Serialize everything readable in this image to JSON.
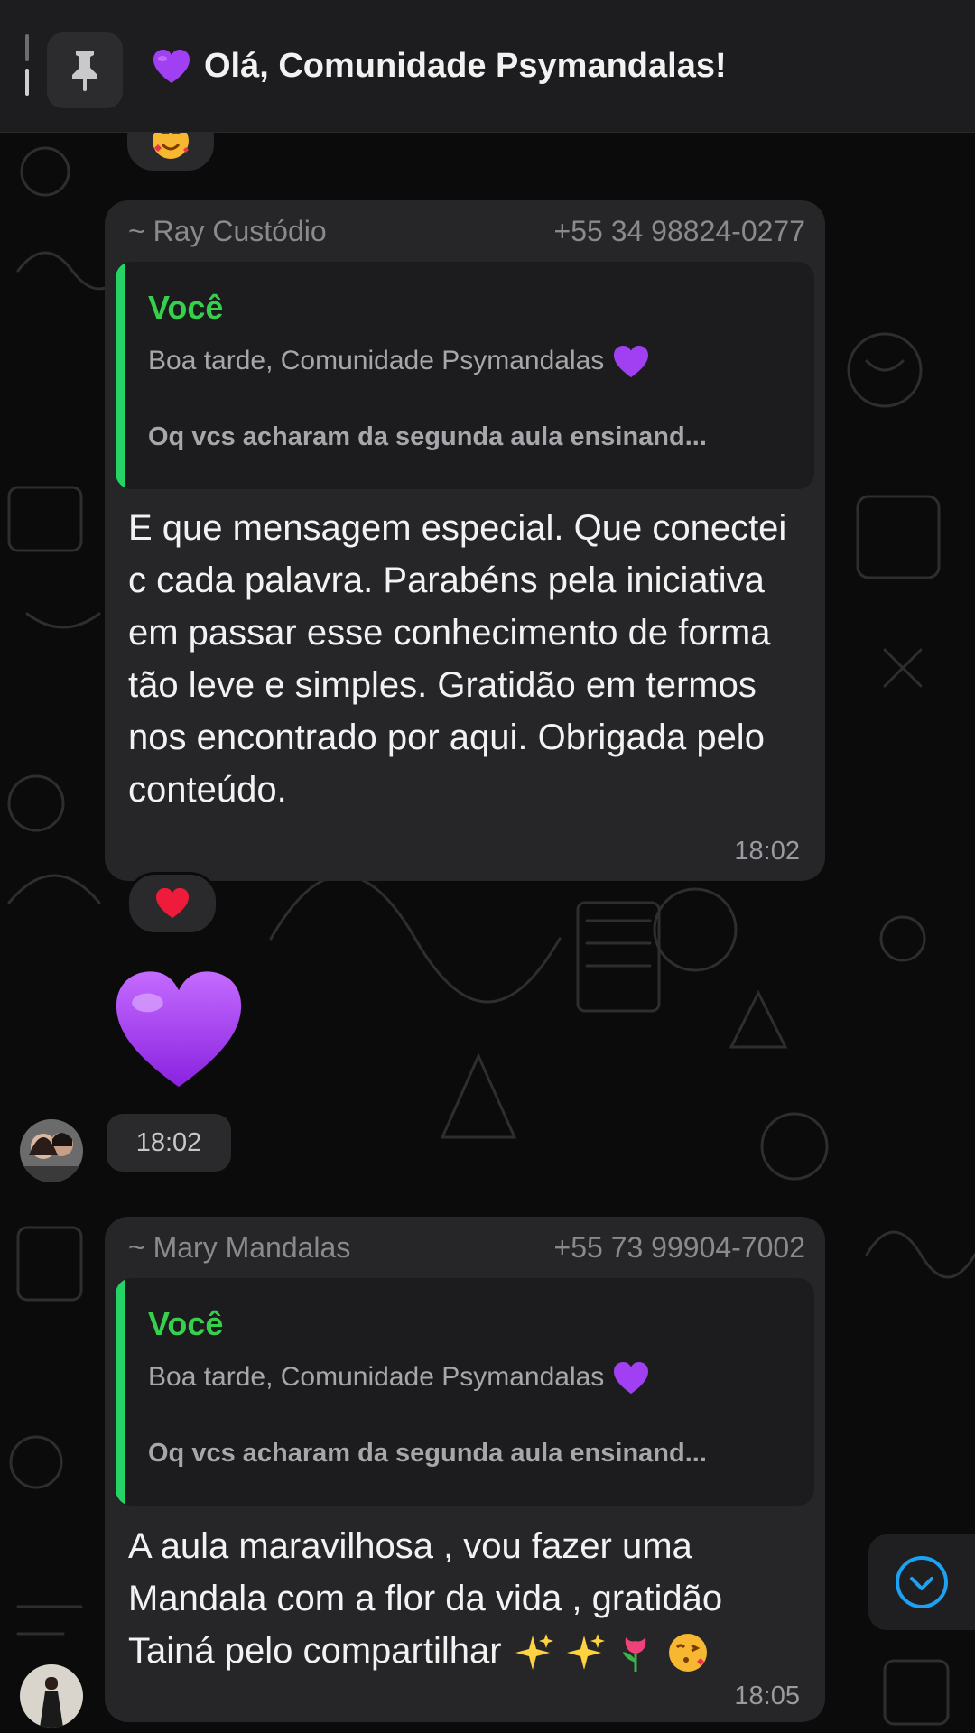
{
  "pinned": {
    "title": "Olá, Comunidade Psymandalas!",
    "icon": "pin-icon",
    "heart_color": "#9b3ff0"
  },
  "messages": [
    {
      "sender": "~ Ray Custódio",
      "phone": "+55 34 98824-0277",
      "quote": {
        "author": "Você",
        "line1": "Boa tarde, Comunidade Psymandalas",
        "line2": "Oq vcs acharam da segunda aula ensinand..."
      },
      "text": "E que mensagem especial. Que conectei c cada palavra. Parabéns pela iniciativa em passar esse conhecimento de forma tão leve e simples. Gratidão em termos nos encontrado por aqui. Obrigada pelo conteúdo.",
      "time": "18:02",
      "reaction": "red-heart"
    },
    {
      "type": "sticker",
      "sticker": "purple-heart",
      "time": "18:02"
    },
    {
      "sender": "~ Mary Mandalas",
      "phone": "+55 73 99904-7002",
      "quote": {
        "author": "Você",
        "line1": "Boa tarde, Comunidade Psymandalas",
        "line2": "Oq vcs acharam da segunda aula ensinand..."
      },
      "text": "A aula maravilhosa , vou fazer uma Mandala com a flor da vida , gratidão Tainá pelo compartilhar",
      "text_emojis": [
        "sparkles",
        "sparkles",
        "tulip",
        "face-blowing-kiss"
      ],
      "time": "18:05"
    }
  ],
  "colors": {
    "quote_author": "#35d14a",
    "accent_blue": "#1da1f2",
    "bubble": "#262629"
  }
}
